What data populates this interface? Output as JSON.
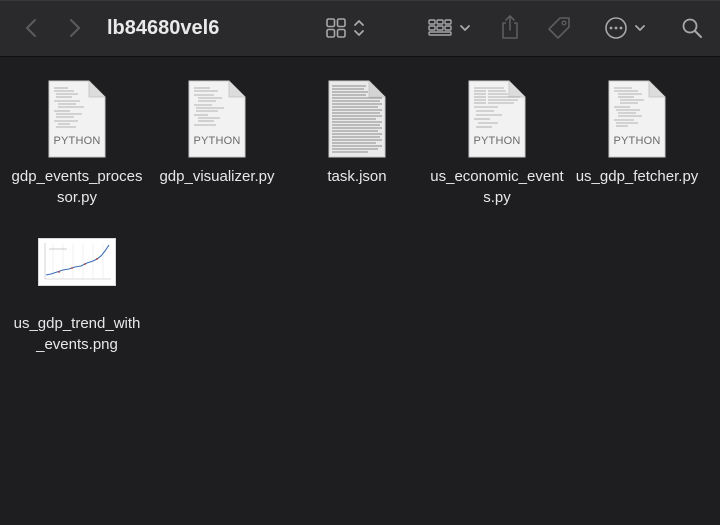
{
  "window": {
    "title": "lb84680vel6"
  },
  "toolbar": {
    "back_icon": "chevron-left-icon",
    "forward_icon": "chevron-right-icon",
    "view_icon": "grid-view-icon",
    "group_icon": "group-by-icon",
    "share_icon": "share-icon",
    "tag_icon": "tag-icon",
    "more_icon": "ellipsis-circle-icon",
    "search_icon": "search-icon"
  },
  "files": [
    {
      "name": "gdp_events_processor.py",
      "kind": "python",
      "badge": "PYTHON"
    },
    {
      "name": "gdp_visualizer.py",
      "kind": "python",
      "badge": "PYTHON"
    },
    {
      "name": "task.json",
      "kind": "json",
      "badge": ""
    },
    {
      "name": "us_economic_events.py",
      "kind": "python",
      "badge": "PYTHON"
    },
    {
      "name": "us_gdp_fetcher.py",
      "kind": "python",
      "badge": "PYTHON"
    },
    {
      "name": "us_gdp_trend_with_events.png",
      "kind": "png",
      "badge": ""
    }
  ],
  "colors": {
    "background": "#1e1e20",
    "toolbar": "#2a2a2c",
    "icon": "#9a9a9c",
    "text": "#e8e8e8"
  }
}
